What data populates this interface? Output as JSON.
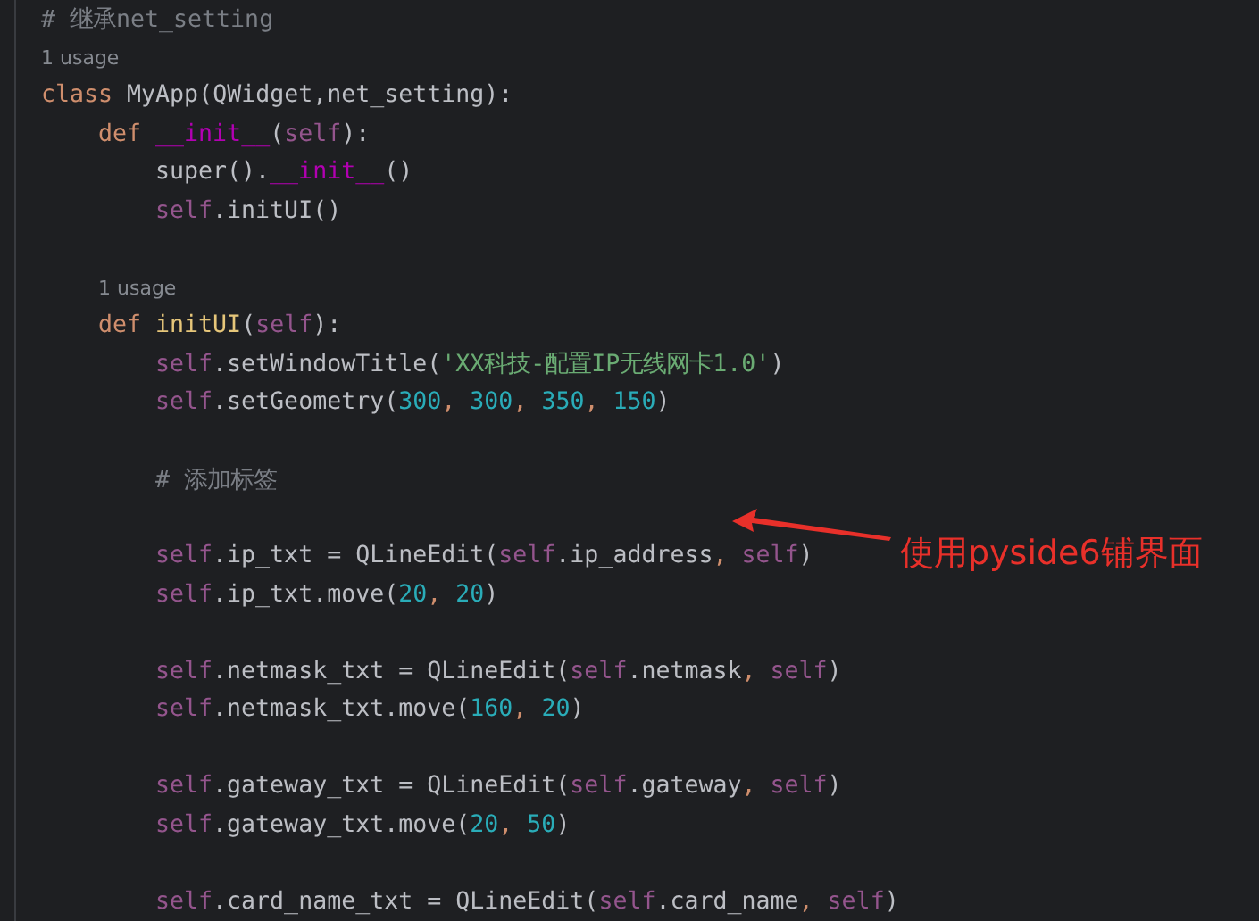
{
  "editor": {
    "lines": [
      {
        "kind": "code",
        "tokens": [
          {
            "kind": "comment",
            "text": "# 继承net_setting"
          }
        ]
      },
      {
        "kind": "usage",
        "tokens": [
          {
            "kind": "hint",
            "text": "1 usage"
          }
        ]
      },
      {
        "kind": "code",
        "tokens": [
          {
            "kind": "keyword",
            "text": "class"
          },
          {
            "kind": "plain",
            "text": " MyApp(QWidget,net_setting):"
          }
        ],
        "children": [
          {
            "kind": "code",
            "tokens": [
              {
                "kind": "keyword",
                "text": "def "
              },
              {
                "kind": "dunder",
                "text": "__init__"
              },
              {
                "kind": "plain",
                "text": "("
              },
              {
                "kind": "self",
                "text": "self"
              },
              {
                "kind": "plain",
                "text": "):"
              }
            ],
            "children": [
              {
                "kind": "code",
                "tokens": [
                  {
                    "kind": "plain",
                    "text": "super()."
                  },
                  {
                    "kind": "dunder",
                    "text": "__init__"
                  },
                  {
                    "kind": "plain",
                    "text": "()"
                  }
                ]
              },
              {
                "kind": "code",
                "tokens": [
                  {
                    "kind": "self",
                    "text": "self"
                  },
                  {
                    "kind": "plain",
                    "text": ".initUI()"
                  }
                ]
              }
            ]
          },
          {
            "kind": "blank"
          },
          {
            "kind": "usage",
            "tokens": [
              {
                "kind": "hint",
                "text": "1 usage"
              }
            ]
          },
          {
            "kind": "code",
            "tokens": [
              {
                "kind": "keyword",
                "text": "def "
              },
              {
                "kind": "function",
                "text": "initUI"
              },
              {
                "kind": "plain",
                "text": "("
              },
              {
                "kind": "self",
                "text": "self"
              },
              {
                "kind": "plain",
                "text": "):"
              }
            ],
            "children": [
              {
                "kind": "code",
                "tokens": [
                  {
                    "kind": "self",
                    "text": "self"
                  },
                  {
                    "kind": "plain",
                    "text": ".setWindowTitle("
                  },
                  {
                    "kind": "string",
                    "text": "'XX科技-配置IP无线网卡1.0'"
                  },
                  {
                    "kind": "plain",
                    "text": ")"
                  }
                ]
              },
              {
                "kind": "code",
                "tokens": [
                  {
                    "kind": "self",
                    "text": "self"
                  },
                  {
                    "kind": "plain",
                    "text": ".setGeometry("
                  },
                  {
                    "kind": "number",
                    "text": "300"
                  },
                  {
                    "kind": "keyword",
                    "text": ", "
                  },
                  {
                    "kind": "number",
                    "text": "300"
                  },
                  {
                    "kind": "keyword",
                    "text": ", "
                  },
                  {
                    "kind": "number",
                    "text": "350"
                  },
                  {
                    "kind": "keyword",
                    "text": ", "
                  },
                  {
                    "kind": "number",
                    "text": "150"
                  },
                  {
                    "kind": "plain",
                    "text": ")"
                  }
                ]
              },
              {
                "kind": "blank"
              },
              {
                "kind": "code",
                "tokens": [
                  {
                    "kind": "comment",
                    "text": "# 添加标签"
                  }
                ]
              },
              {
                "kind": "blank"
              },
              {
                "kind": "code",
                "tokens": [
                  {
                    "kind": "self",
                    "text": "self"
                  },
                  {
                    "kind": "plain",
                    "text": ".ip_txt = QLineEdit("
                  },
                  {
                    "kind": "self",
                    "text": "self"
                  },
                  {
                    "kind": "plain",
                    "text": ".ip_address"
                  },
                  {
                    "kind": "keyword",
                    "text": ", "
                  },
                  {
                    "kind": "self",
                    "text": "self"
                  },
                  {
                    "kind": "plain",
                    "text": ")"
                  }
                ]
              },
              {
                "kind": "code",
                "tokens": [
                  {
                    "kind": "self",
                    "text": "self"
                  },
                  {
                    "kind": "plain",
                    "text": ".ip_txt.move("
                  },
                  {
                    "kind": "number",
                    "text": "20"
                  },
                  {
                    "kind": "keyword",
                    "text": ", "
                  },
                  {
                    "kind": "number",
                    "text": "20"
                  },
                  {
                    "kind": "plain",
                    "text": ")"
                  }
                ]
              },
              {
                "kind": "blank"
              },
              {
                "kind": "code",
                "tokens": [
                  {
                    "kind": "self",
                    "text": "self"
                  },
                  {
                    "kind": "plain",
                    "text": ".netmask_txt = QLineEdit("
                  },
                  {
                    "kind": "self",
                    "text": "self"
                  },
                  {
                    "kind": "plain",
                    "text": ".netmask"
                  },
                  {
                    "kind": "keyword",
                    "text": ", "
                  },
                  {
                    "kind": "self",
                    "text": "self"
                  },
                  {
                    "kind": "plain",
                    "text": ")"
                  }
                ]
              },
              {
                "kind": "code",
                "tokens": [
                  {
                    "kind": "self",
                    "text": "self"
                  },
                  {
                    "kind": "plain",
                    "text": ".netmask_txt.move("
                  },
                  {
                    "kind": "number",
                    "text": "160"
                  },
                  {
                    "kind": "keyword",
                    "text": ", "
                  },
                  {
                    "kind": "number",
                    "text": "20"
                  },
                  {
                    "kind": "plain",
                    "text": ")"
                  }
                ]
              },
              {
                "kind": "blank"
              },
              {
                "kind": "code",
                "tokens": [
                  {
                    "kind": "self",
                    "text": "self"
                  },
                  {
                    "kind": "plain",
                    "text": ".gateway_txt = QLineEdit("
                  },
                  {
                    "kind": "self",
                    "text": "self"
                  },
                  {
                    "kind": "plain",
                    "text": ".gateway"
                  },
                  {
                    "kind": "keyword",
                    "text": ", "
                  },
                  {
                    "kind": "self",
                    "text": "self"
                  },
                  {
                    "kind": "plain",
                    "text": ")"
                  }
                ]
              },
              {
                "kind": "code",
                "tokens": [
                  {
                    "kind": "self",
                    "text": "self"
                  },
                  {
                    "kind": "plain",
                    "text": ".gateway_txt.move("
                  },
                  {
                    "kind": "number",
                    "text": "20"
                  },
                  {
                    "kind": "keyword",
                    "text": ", "
                  },
                  {
                    "kind": "number",
                    "text": "50"
                  },
                  {
                    "kind": "plain",
                    "text": ")"
                  }
                ]
              },
              {
                "kind": "blank"
              },
              {
                "kind": "code",
                "tokens": [
                  {
                    "kind": "self",
                    "text": "self"
                  },
                  {
                    "kind": "plain",
                    "text": ".card_name_txt = QLineEdit("
                  },
                  {
                    "kind": "self",
                    "text": "self"
                  },
                  {
                    "kind": "plain",
                    "text": ".card_name"
                  },
                  {
                    "kind": "keyword",
                    "text": ", "
                  },
                  {
                    "kind": "self",
                    "text": "self"
                  },
                  {
                    "kind": "plain",
                    "text": ")"
                  }
                ]
              }
            ]
          }
        ]
      }
    ]
  },
  "annotation": {
    "text": "使用pyside6铺界面"
  }
}
